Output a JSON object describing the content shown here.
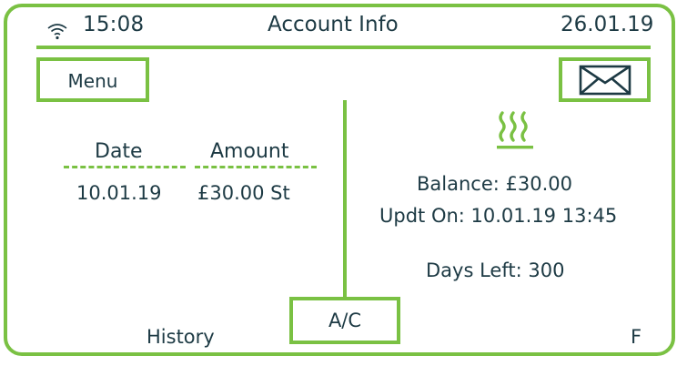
{
  "status_bar": {
    "time": "15:08",
    "title": "Account Info",
    "date": "26.01.19"
  },
  "menu": {
    "label": "Menu"
  },
  "history_table": {
    "headers": [
      "Date",
      "Amount"
    ],
    "rows": [
      [
        "10.01.19",
        "£30.00 St"
      ]
    ]
  },
  "account": {
    "balance": "Balance: £30.00",
    "updated": "Updt On: 10.01.19 13:45",
    "days_left": "Days Left: 300"
  },
  "softkeys": {
    "left": "History",
    "center": "A/C",
    "right": "F"
  },
  "icons": {
    "signal": "wifi-icon",
    "messages": "envelope-icon",
    "heating": "heat-icon"
  },
  "colors": {
    "accent": "#7ac143",
    "text": "#1d3a44",
    "background": "#ffffff"
  }
}
